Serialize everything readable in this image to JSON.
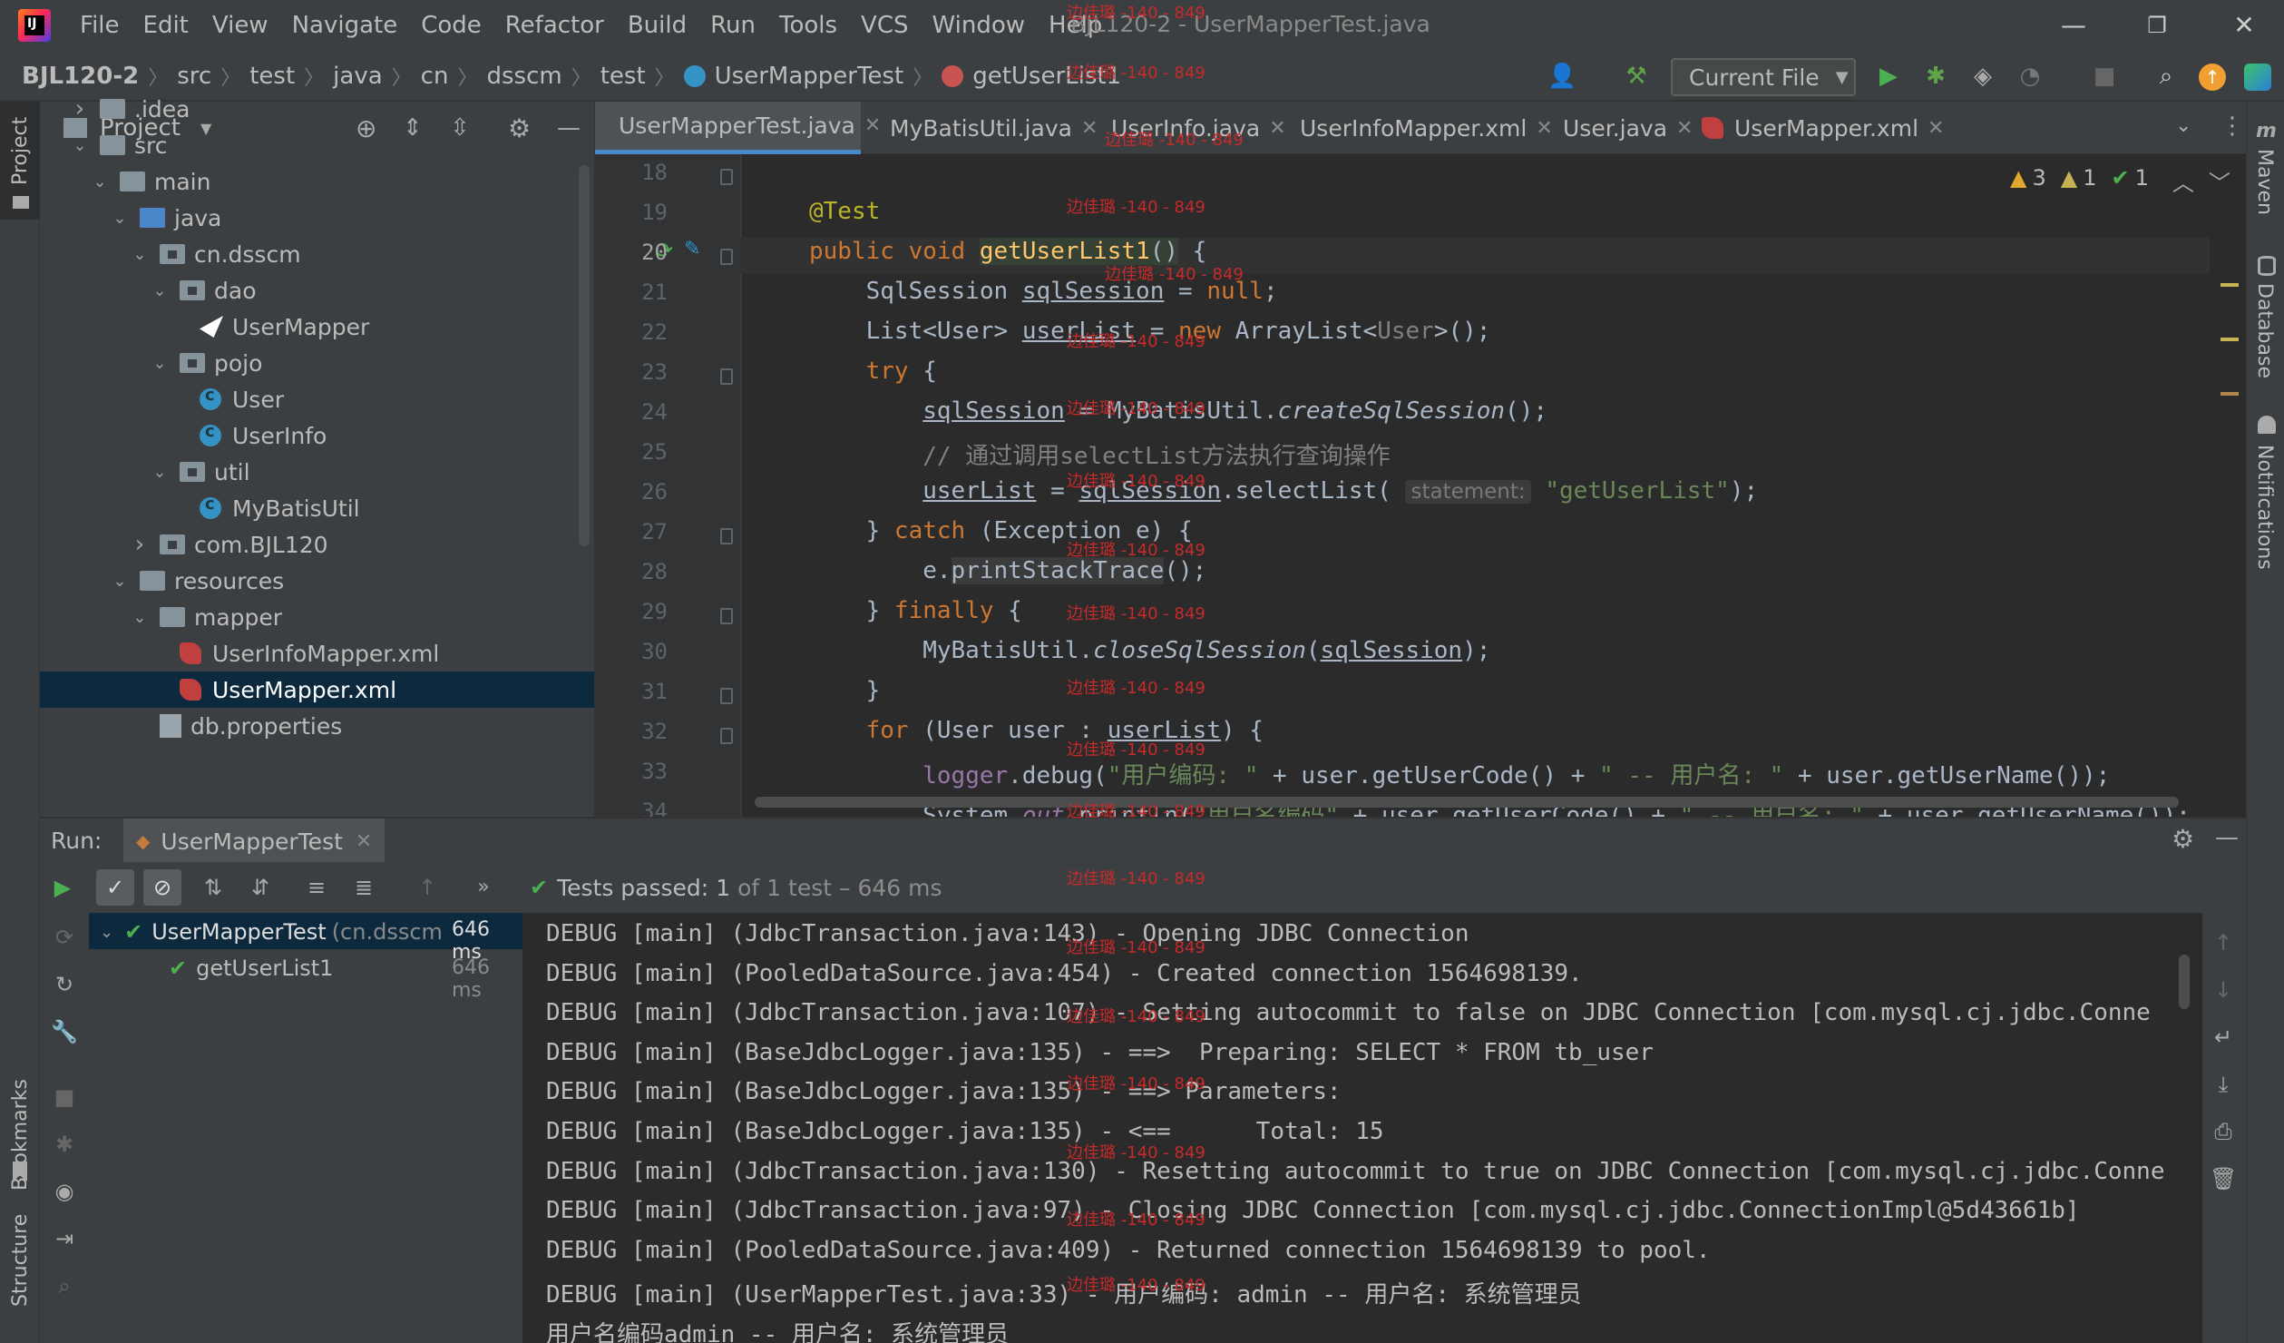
{
  "window": {
    "title": "BJL120-2 - UserMapperTest.java",
    "menu": [
      "File",
      "Edit",
      "View",
      "Navigate",
      "Code",
      "Refactor",
      "Build",
      "Run",
      "Tools",
      "VCS",
      "Window",
      "Help"
    ]
  },
  "breadcrumb": [
    "BJL120-2",
    "src",
    "test",
    "java",
    "cn",
    "dsscm",
    "test",
    "UserMapperTest",
    "getUserList1"
  ],
  "toolbar": {
    "run_config": "Current File"
  },
  "watermark": "边佳璐 -140 - 849",
  "project": {
    "title": "Project",
    "tree": [
      {
        "label": ".idea",
        "depth": 1,
        "expanded": false,
        "type": "folder"
      },
      {
        "label": "src",
        "depth": 1,
        "expanded": true,
        "type": "folder"
      },
      {
        "label": "main",
        "depth": 2,
        "expanded": true,
        "type": "folder"
      },
      {
        "label": "java",
        "depth": 3,
        "expanded": true,
        "type": "src"
      },
      {
        "label": "cn.dsscm",
        "depth": 4,
        "expanded": true,
        "type": "pkg"
      },
      {
        "label": "dao",
        "depth": 5,
        "expanded": true,
        "type": "pkg"
      },
      {
        "label": "UserMapper",
        "depth": 6,
        "type": "iface"
      },
      {
        "label": "pojo",
        "depth": 5,
        "expanded": true,
        "type": "pkg"
      },
      {
        "label": "User",
        "depth": 6,
        "type": "class"
      },
      {
        "label": "UserInfo",
        "depth": 6,
        "type": "class"
      },
      {
        "label": "util",
        "depth": 5,
        "expanded": true,
        "type": "pkg"
      },
      {
        "label": "MyBatisUtil",
        "depth": 6,
        "type": "class"
      },
      {
        "label": "com.BJL120",
        "depth": 4,
        "expanded": false,
        "type": "pkg"
      },
      {
        "label": "resources",
        "depth": 3,
        "expanded": true,
        "type": "folder"
      },
      {
        "label": "mapper",
        "depth": 4,
        "expanded": true,
        "type": "folder"
      },
      {
        "label": "UserInfoMapper.xml",
        "depth": 5,
        "type": "xml"
      },
      {
        "label": "UserMapper.xml",
        "depth": 5,
        "type": "xml",
        "selected": true
      },
      {
        "label": "db.properties",
        "depth": 4,
        "type": "prop"
      }
    ]
  },
  "tabs": [
    {
      "label": "UserMapperTest.java",
      "active": true,
      "type": "class"
    },
    {
      "label": "MyBatisUtil.java",
      "type": "class"
    },
    {
      "label": "UserInfo.java",
      "type": "class"
    },
    {
      "label": "UserInfoMapper.xml",
      "type": "xml"
    },
    {
      "label": "User.java",
      "type": "class"
    },
    {
      "label": "UserMapper.xml",
      "type": "xml"
    }
  ],
  "inspections": {
    "warnings": "3",
    "weak": "1",
    "ok": "1"
  },
  "editor": {
    "line_numbers": [
      "18",
      "19",
      "20",
      "21",
      "22",
      "23",
      "24",
      "25",
      "26",
      "27",
      "28",
      "29",
      "30",
      "31",
      "32",
      "33",
      "34"
    ],
    "hint_statement": "statement:"
  },
  "run": {
    "label": "Run:",
    "tab": "UserMapperTest",
    "status_prefix": "Tests passed:",
    "status_count": "1",
    "status_suffix": "of 1 test – 646 ms",
    "tests": [
      {
        "name": "UserMapperTest",
        "pkg": "(cn.dsscm",
        "time": "646 ms"
      },
      {
        "name": "getUserList1",
        "time": "646 ms"
      }
    ],
    "console": [
      "DEBUG [main] (JdbcTransaction.java:143) - Opening JDBC Connection",
      "DEBUG [main] (PooledDataSource.java:454) - Created connection 1564698139.",
      "DEBUG [main] (JdbcTransaction.java:107) - Setting autocommit to false on JDBC Connection [com.mysql.cj.jdbc.Conne",
      "DEBUG [main] (BaseJdbcLogger.java:135) - ==>  Preparing: SELECT * FROM tb_user",
      "DEBUG [main] (BaseJdbcLogger.java:135) - ==> Parameters: ",
      "DEBUG [main] (BaseJdbcLogger.java:135) - <==      Total: 15",
      "DEBUG [main] (JdbcTransaction.java:130) - Resetting autocommit to true on JDBC Connection [com.mysql.cj.jdbc.Conne",
      "DEBUG [main] (JdbcTransaction.java:97) - Closing JDBC Connection [com.mysql.cj.jdbc.ConnectionImpl@5d43661b]",
      "DEBUG [main] (PooledDataSource.java:409) - Returned connection 1564698139 to pool.",
      "DEBUG [main] (UserMapperTest.java:33) - 用户编码: admin -- 用户名: 系统管理员",
      "用户名编码admin -- 用户名: 系统管理员"
    ]
  },
  "side_labels": {
    "left": [
      "Project",
      "Bookmarks",
      "Structure"
    ],
    "right": [
      "Maven",
      "Database",
      "Notifications"
    ]
  }
}
